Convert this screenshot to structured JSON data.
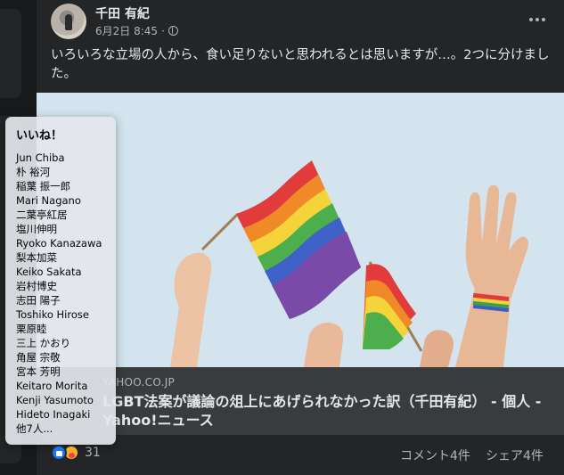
{
  "post": {
    "author": "千田 有紀",
    "timestamp": "6月2日 8:45",
    "privacy_icon": "globe-icon",
    "text": "いろいろな立場の人から、食い足りないと思われるとは思いますが…。2つに分けました。",
    "link": {
      "domain": "YAHOO.CO.JP",
      "title": "LGBT法案が議論の俎上にあげられなかった訳（千田有紀） - 個人 - Yahoo!ニュース",
      "image_icon": "rainbow-flags-photo"
    },
    "footer": {
      "reaction_icons": [
        "like-icon",
        "care-icon"
      ],
      "reaction_count": "31",
      "comments": "コメント4件",
      "shares": "シェア4件"
    }
  },
  "tooltip": {
    "title": "いいね！",
    "names": [
      "Jun Chiba",
      "朴 裕河",
      "稲葉 振一郎",
      "Mari Nagano",
      "二葉亭紅居",
      "塩川伸明",
      "Ryoko Kanazawa",
      "梨本加菜",
      "Keiko Sakata",
      "岩村博史",
      "志田 陽子",
      "Toshiko Hirose",
      "栗原睦",
      "三上 かおり",
      "角屋 宗敬",
      "宮本 芳明",
      "Keitaro Morita",
      "Kenji Yasumoto",
      "Hideto Inagaki",
      "他7人..."
    ]
  },
  "colors": {
    "background": "#18191a",
    "card": "#242526",
    "caption": "#3a3b3c",
    "like_blue": "#1877f2",
    "text_primary": "#e4e6eb",
    "text_secondary": "#b0b3b8"
  }
}
